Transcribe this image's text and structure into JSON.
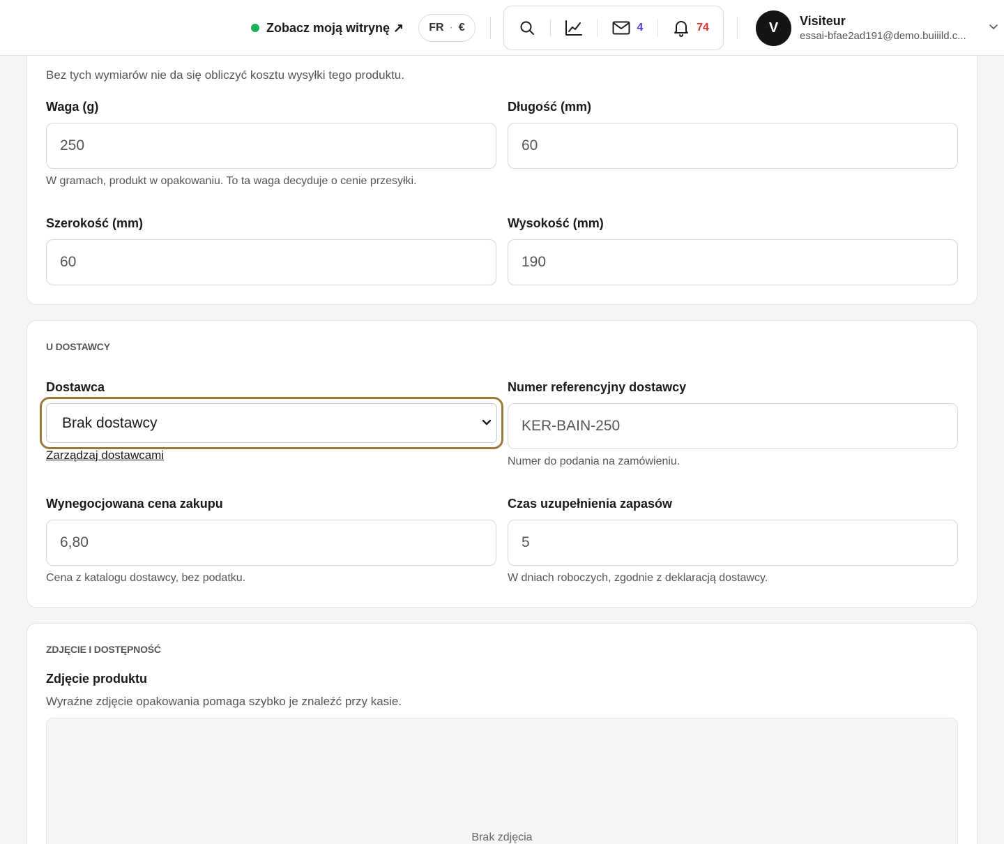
{
  "topbar": {
    "site_link_label": "Zobacz moją witrynę ↗",
    "lang": "FR",
    "currency": "€",
    "messages_count": "4",
    "notifications_count": "74",
    "user": {
      "avatar_letter": "V",
      "name": "Visiteur",
      "email": "essai-bfae2ad191@demo.buiiild.c..."
    },
    "icons": [
      "search-icon",
      "chart-icon",
      "mail-icon",
      "bell-icon",
      "chevron-down-icon"
    ],
    "colors": {
      "online_dot": "#1fb15a",
      "messages_badge": "#4a3fd6",
      "notifications_badge": "#d43232"
    }
  },
  "dimensions": {
    "description": "Bez tych wymiarów nie da się obliczyć kosztu wysyłki tego produktu.",
    "weight": {
      "label": "Waga (g)",
      "value": "250",
      "help": "W gramach, produkt w opakowaniu. To ta waga decyduje o cenie przesyłki."
    },
    "length": {
      "label": "Długość (mm)",
      "value": "60"
    },
    "width": {
      "label": "Szerokość (mm)",
      "value": "60"
    },
    "height": {
      "label": "Wysokość (mm)",
      "value": "190"
    }
  },
  "supplier": {
    "section_title": "U DOSTAWCY",
    "supplier_field": {
      "label": "Dostawca",
      "selected": "Brak dostawcy",
      "manage_link": "Zarządzaj dostawcami"
    },
    "reference": {
      "label": "Numer referencyjny dostawcy",
      "value": "KER-BAIN-250",
      "help": "Numer do podania na zamówieniu."
    },
    "price": {
      "label": "Wynegocjowana cena zakupu",
      "value": "6,80",
      "help": "Cena z katalogu dostawcy, bez podatku."
    },
    "lead_time": {
      "label": "Czas uzupełnienia zapasów",
      "value": "5",
      "help": "W dniach roboczych, zgodnie z deklaracją dostawcy."
    },
    "focus_color": "#9a7a3a"
  },
  "photo": {
    "section_title": "ZDJĘCIE I DOSTĘPNOŚĆ",
    "label": "Zdjęcie produktu",
    "description": "Wyraźne zdjęcie opakowania pomaga szybko je znaleźć przy kasie.",
    "empty_text": "Brak zdjęcia"
  }
}
